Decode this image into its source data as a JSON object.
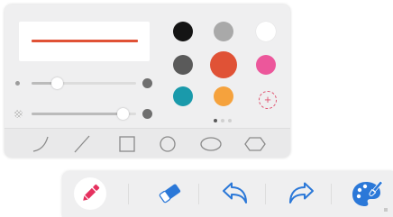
{
  "pen_settings": {
    "preview_stroke_color": "#e05236",
    "stroke_size_percent": 24,
    "opacity_percent": 87,
    "colors": [
      {
        "name": "black",
        "hex": "#141414",
        "selected": false
      },
      {
        "name": "gray",
        "hex": "#a9a9a9",
        "selected": false
      },
      {
        "name": "white",
        "hex": "#ffffff",
        "selected": false
      },
      {
        "name": "dark-gray",
        "hex": "#5a5a5a",
        "selected": false
      },
      {
        "name": "red-orange",
        "hex": "#e05236",
        "selected": true
      },
      {
        "name": "pink",
        "hex": "#ec579b",
        "selected": false
      },
      {
        "name": "teal",
        "hex": "#1a9aab",
        "selected": false
      },
      {
        "name": "orange",
        "hex": "#f5a23d",
        "selected": false
      }
    ],
    "custom_color_glyph": "+",
    "color_page": 1,
    "color_page_count": 3,
    "shapes": [
      "curve",
      "line",
      "rectangle",
      "circle",
      "ellipse",
      "hexagon"
    ]
  },
  "toolbar": {
    "tools": [
      {
        "name": "pen",
        "selected": true,
        "color": "#e5315f"
      },
      {
        "name": "eraser",
        "selected": false,
        "color": "#2b78d8"
      },
      {
        "name": "undo",
        "selected": false,
        "color": "#2b78d8"
      },
      {
        "name": "redo",
        "selected": false,
        "color": "#2b78d8"
      },
      {
        "name": "palette",
        "selected": false,
        "color": "#2b78d8"
      }
    ]
  },
  "theme": {
    "panel_bg": "#efeff0",
    "accent_pink": "#e5315f",
    "accent_blue": "#2b78d8"
  }
}
